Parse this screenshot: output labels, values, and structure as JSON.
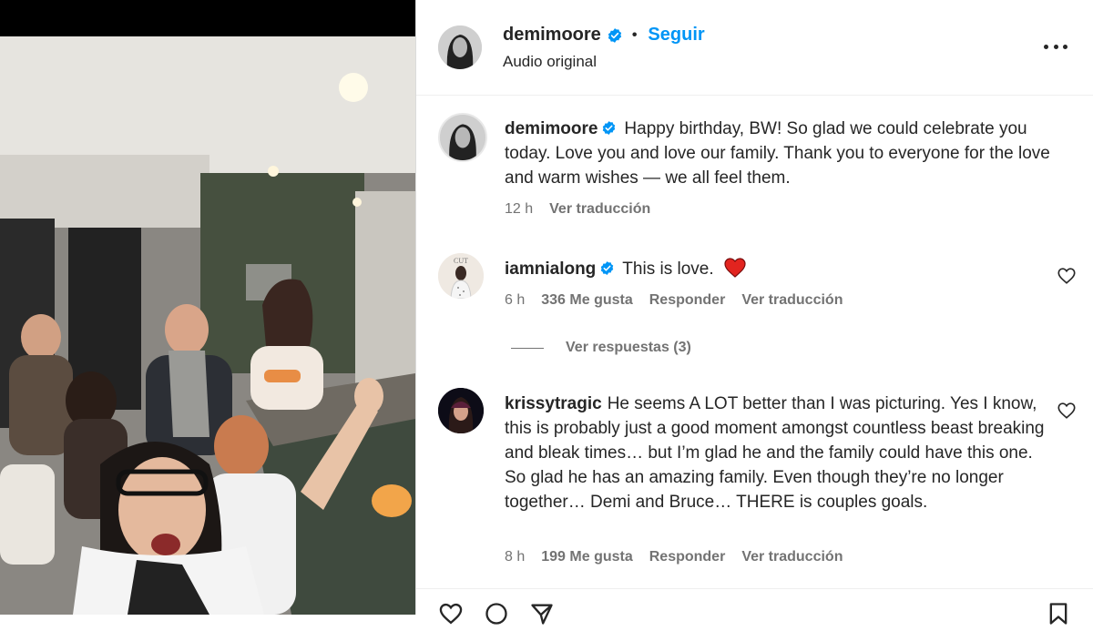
{
  "header": {
    "username": "demimoore",
    "separator": "•",
    "follow_label": "Seguir",
    "subtitle": "Audio original"
  },
  "caption": {
    "username": "demimoore",
    "text": "Happy birthday, BW! So glad we could celebrate you today. Love you and love our family. Thank you to everyone for the love and warm wishes — we all feel them.",
    "time": "12 h",
    "translate": "Ver traducción"
  },
  "comments": [
    {
      "username": "iamnialong",
      "text": "This is love.",
      "emoji": "❤️",
      "time": "6 h",
      "likes": "336 Me gusta",
      "reply": "Responder",
      "translate": "Ver traducción"
    },
    {
      "username": "krissytragic",
      "text": "He seems A LOT better than I was picturing. Yes I know, this is probably just a good moment amongst countless beast breaking and bleak times… but I’m glad he and the family could have this one. So glad he has an amazing family. Even though they’re no longer together… Demi and Bruce… THERE is couples goals.",
      "time": "8 h",
      "likes": "199 Me gusta",
      "reply": "Responder",
      "translate": "Ver traducción"
    }
  ],
  "view_replies": "Ver respuestas (3)",
  "colors": {
    "accent": "#0095f6",
    "verified": "#0095f6",
    "muted": "#737373",
    "heart_red": "#e0245e"
  },
  "icons": [
    "verified-badge-icon",
    "more-options-icon",
    "heart-outline-icon",
    "comment-icon",
    "share-icon",
    "bookmark-icon"
  ]
}
